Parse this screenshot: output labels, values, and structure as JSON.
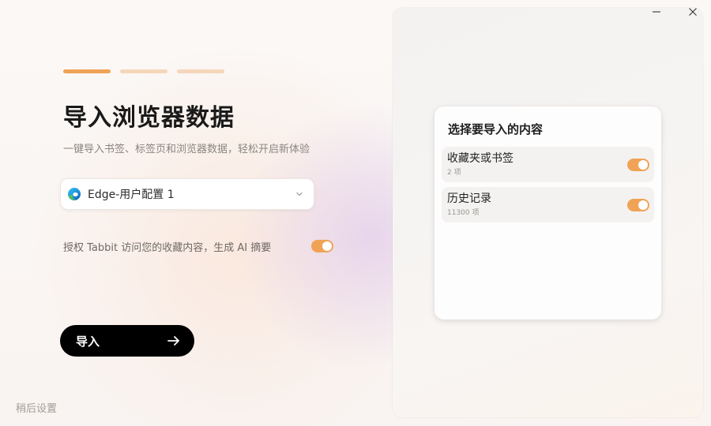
{
  "window": {
    "minimize_icon": "minimize-icon",
    "close_icon": "close-icon"
  },
  "progress": {
    "total_steps": 3,
    "current_step": 1,
    "colors": {
      "active": "#f0a356",
      "inactive": "#f5d6ba"
    }
  },
  "main": {
    "title": "导入浏览器数据",
    "subtitle": "一键导入书签、标签页和浏览器数据，轻松开启新体验",
    "profile_select": {
      "icon": "edge-browser-icon",
      "selected": "Edge-用户配置 1",
      "dropdown_icon": "chevron-down-icon"
    },
    "authorize": {
      "label": "授权 Tabbit 访问您的收藏内容，生成 AI 摘要",
      "enabled": true
    },
    "import_button": {
      "label": "导入",
      "icon": "arrow-right-icon"
    },
    "later_link": "稍后设置"
  },
  "preview": {
    "card_title": "选择要导入的内容",
    "options": [
      {
        "label": "收藏夹或书签",
        "count": "2 项",
        "enabled": true
      },
      {
        "label": "历史记录",
        "count": "11300 项",
        "enabled": true
      }
    ]
  },
  "colors": {
    "accent": "#f0a356",
    "button_bg": "#000000",
    "text_primary": "#1a1a1a",
    "text_secondary": "#8a8580"
  }
}
